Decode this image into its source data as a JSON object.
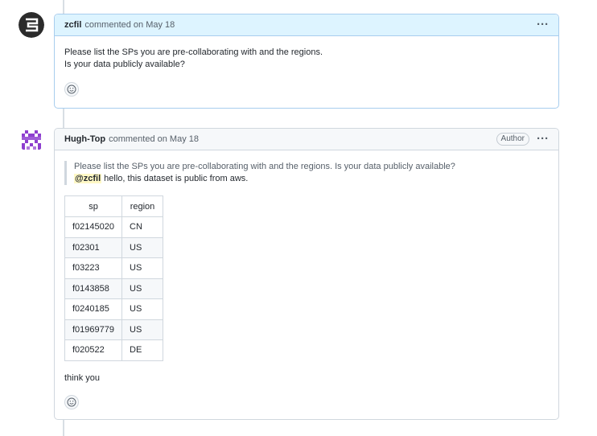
{
  "comments": [
    {
      "author": "zcfil",
      "meta": "commented on May 18",
      "lines": [
        "Please list the SPs you are pre-collaborating with and the regions.",
        "Is your data publicly available?"
      ]
    },
    {
      "author": "Hugh-Top",
      "meta": "commented on May 18",
      "badge": "Author",
      "quote": "Please list the SPs you are pre-collaborating with and the regions. Is your data publicly available?",
      "mention": "@zcfil",
      "reply": " hello, this dataset is public from aws.",
      "table": {
        "headers": [
          "sp",
          "region"
        ],
        "rows": [
          [
            "f02145020",
            "CN"
          ],
          [
            "f02301",
            "US"
          ],
          [
            "f03223",
            "US"
          ],
          [
            "f0143858",
            "US"
          ],
          [
            "f0240185",
            "US"
          ],
          [
            "f01969779",
            "US"
          ],
          [
            "f020522",
            "DE"
          ]
        ]
      },
      "closing": "think you"
    }
  ],
  "icons": {
    "more": "kebab-horizontal-icon",
    "reaction": "smiley-icon"
  },
  "colors": {
    "highlight_header": "#ddf4ff",
    "highlight_border": "#a8cdee",
    "mention_bg": "#fff8c5",
    "avatar2": "#8e3fcf"
  }
}
